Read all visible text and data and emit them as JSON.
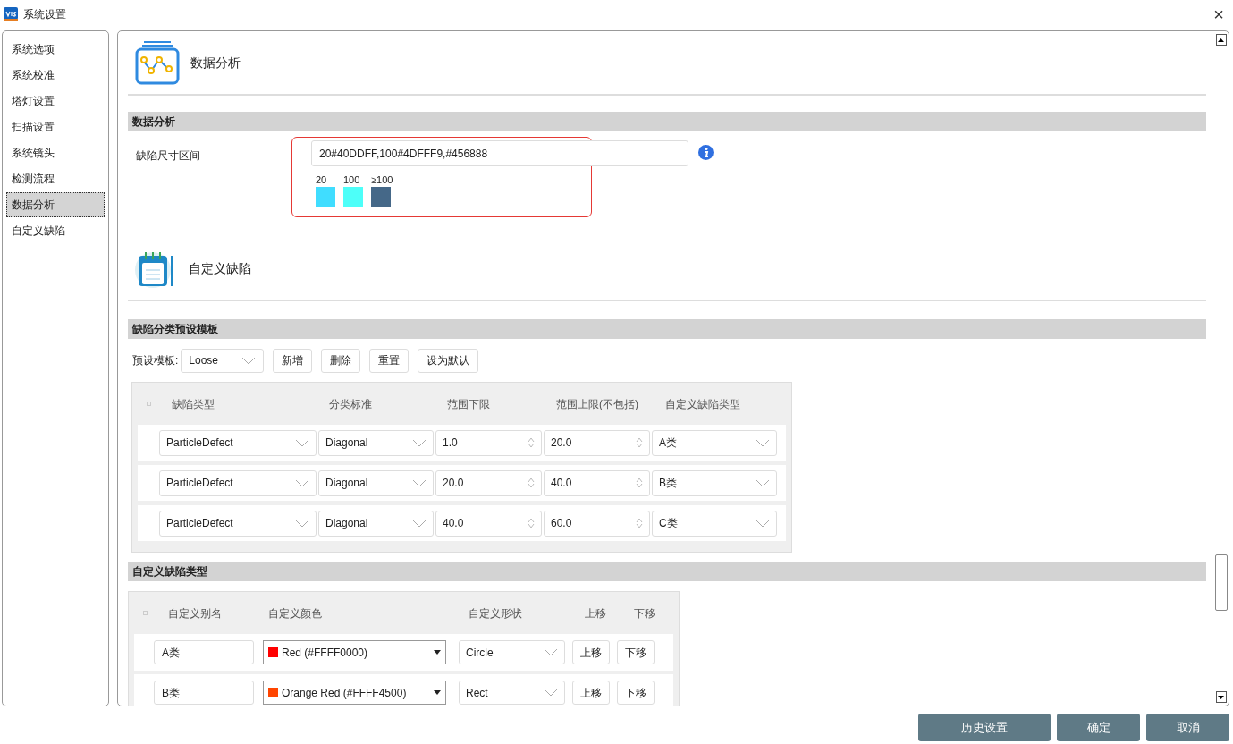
{
  "window": {
    "title": "系统设置",
    "close": "×"
  },
  "sidebar": {
    "items": [
      {
        "label": "系统选项",
        "selected": false
      },
      {
        "label": "系统校准",
        "selected": false
      },
      {
        "label": "塔灯设置",
        "selected": false
      },
      {
        "label": "扫描设置",
        "selected": false
      },
      {
        "label": "系统镜头",
        "selected": false
      },
      {
        "label": "检测流程",
        "selected": false
      },
      {
        "label": "数据分析",
        "selected": true
      },
      {
        "label": "自定义缺陷",
        "selected": false
      }
    ]
  },
  "data_analysis": {
    "heading": "数据分析",
    "section": "数据分析",
    "field_label": "缺陷尺寸区间",
    "field_value": "20#40DDFF,100#4DFFF9,#456888",
    "swatches": [
      {
        "label": "20",
        "color": "#40ddff"
      },
      {
        "label": "100",
        "color": "#4dfff9"
      },
      {
        "label": "≥100",
        "color": "#456888"
      }
    ]
  },
  "custom_defect": {
    "heading": "自定义缺陷",
    "template_section": "缺陷分类预设模板",
    "template_label": "预设模板:",
    "template_value": "Loose",
    "buttons": [
      "新增",
      "删除",
      "重置",
      "设为默认"
    ],
    "columns": [
      "缺陷类型",
      "分类标准",
      "范围下限",
      "范围上限(不包括)",
      "自定义缺陷类型"
    ],
    "rows": [
      {
        "type": "ParticleDefect",
        "standard": "Diagonal",
        "min": "1.0",
        "max": "20.0",
        "custom": "A类"
      },
      {
        "type": "ParticleDefect",
        "standard": "Diagonal",
        "min": "20.0",
        "max": "40.0",
        "custom": "B类"
      },
      {
        "type": "ParticleDefect",
        "standard": "Diagonal",
        "min": "40.0",
        "max": "60.0",
        "custom": "C类"
      }
    ],
    "types_section": "自定义缺陷类型",
    "type_columns": [
      "自定义别名",
      "自定义颜色",
      "自定义形状",
      "上移",
      "下移"
    ],
    "types": [
      {
        "alias": "A类",
        "color": "#ff0000",
        "color_label": "Red (#FFFF0000)",
        "shape": "Circle",
        "up": "上移",
        "down": "下移"
      },
      {
        "alias": "B类",
        "color": "#ff4500",
        "color_label": "Orange Red (#FFFF4500)",
        "shape": "Rect",
        "up": "上移",
        "down": "下移"
      }
    ]
  },
  "footer": {
    "buttons": [
      "历史设置",
      "确定",
      "取消"
    ]
  }
}
